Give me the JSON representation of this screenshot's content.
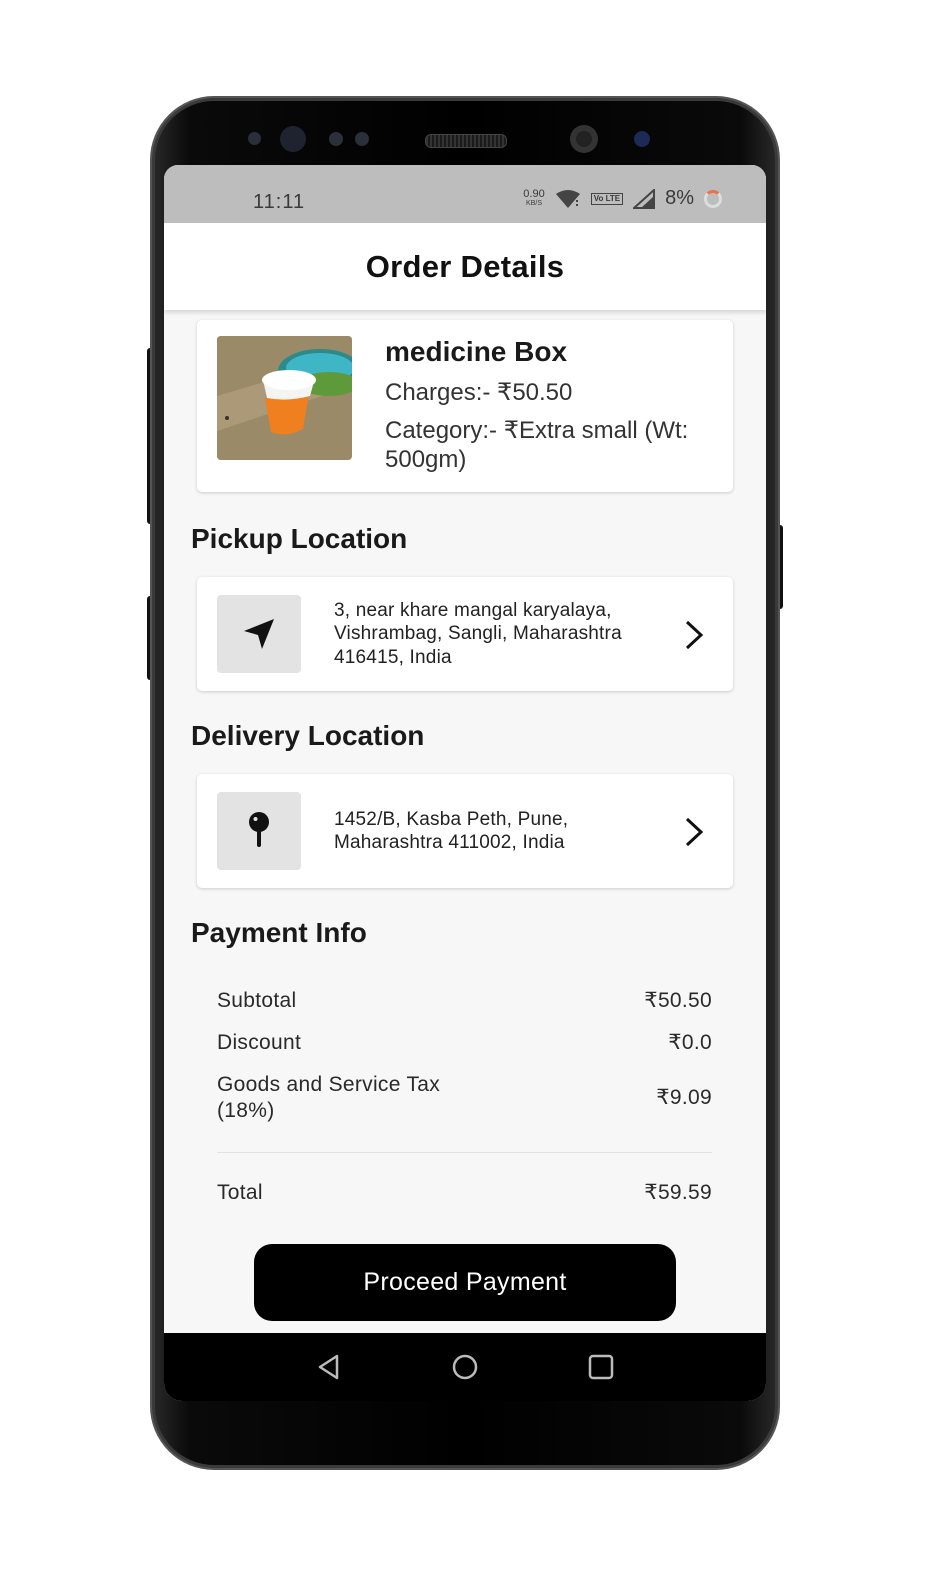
{
  "status_bar": {
    "time": "11:11",
    "speed_value": "0.90",
    "speed_unit": "KB/S",
    "network_badge": "Vo LTE",
    "battery": "8%",
    "icons": [
      "wifi-icon",
      "volte-icon",
      "signal-icon",
      "battery-ring-icon"
    ]
  },
  "header": {
    "title": "Order Details"
  },
  "item": {
    "name": "medicine Box",
    "charges": "Charges:- ₹50.50",
    "category": "Category:- ₹Extra small (Wt: 500gm)"
  },
  "pickup": {
    "section_title": "Pickup Location",
    "address": "3, near khare mangal karyalaya, Vishrambag, Sangli, Maharashtra 416415, India",
    "icon": "navigation-arrow-icon"
  },
  "delivery": {
    "section_title": "Delivery Location",
    "address": "1452/B, Kasba Peth, Pune, Maharashtra 411002, India",
    "icon": "map-pin-icon"
  },
  "payment": {
    "section_title": "Payment Info",
    "rows": [
      {
        "label": "Subtotal",
        "value": "₹50.50"
      },
      {
        "label": "Discount",
        "value": "₹0.0"
      },
      {
        "label": "Goods and Service Tax (18%)",
        "value": "₹9.09"
      }
    ],
    "total_label": "Total",
    "total_value": "₹59.59"
  },
  "actions": {
    "proceed_label": "Proceed Payment"
  },
  "nav": {
    "icons": [
      "back-icon",
      "home-icon",
      "recents-icon"
    ]
  }
}
